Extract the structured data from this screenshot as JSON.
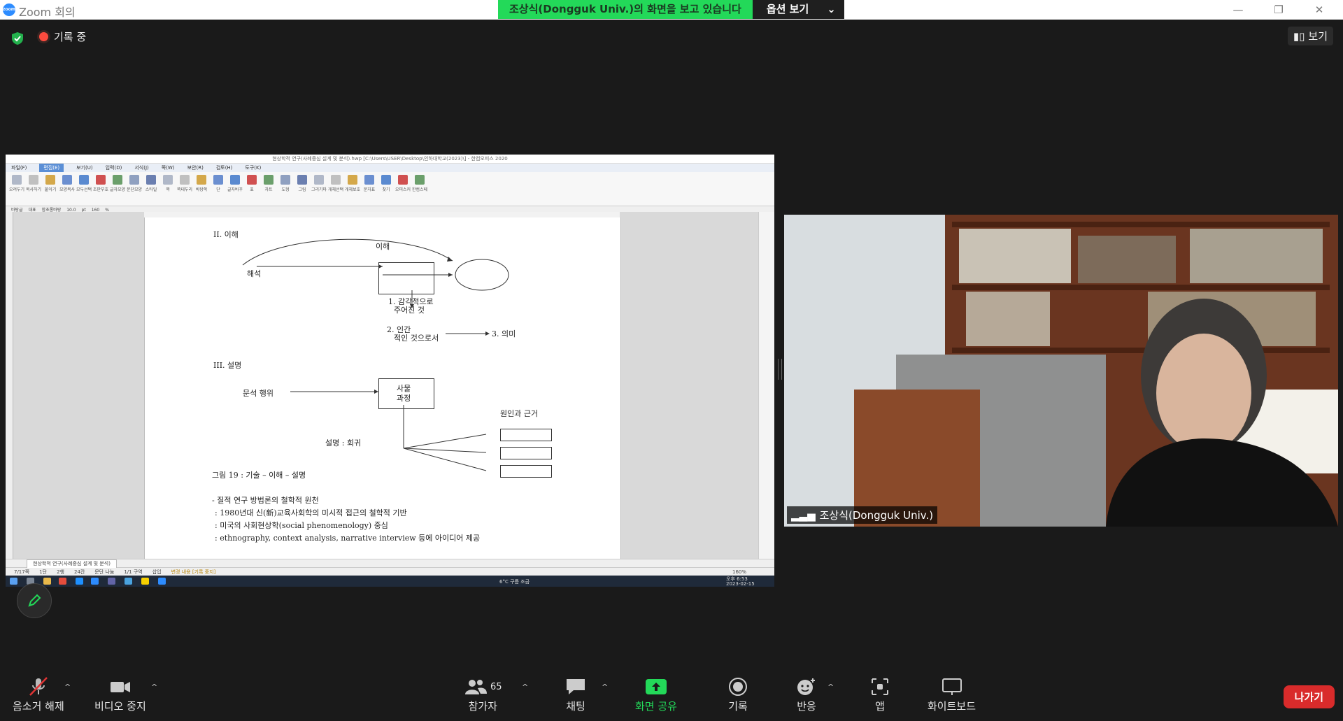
{
  "window": {
    "title": "Zoom 회의",
    "logo_text": "zoom",
    "banner_text": "조상식(Dongguk  Univ.)의 화면을 보고 있습니다",
    "banner_options": "옵션 보기"
  },
  "meeting": {
    "recording_label": "기록 중",
    "view_label": "보기"
  },
  "shared_screen": {
    "hwp_title": "현상학적 연구(사례중심 설계 및 분석).hwp [C:\\Users\\USER\\Desktop\\인하대학교(2023)\\] - 한컴오피스 2020",
    "menu": [
      "파일(F)",
      "편집(E)",
      "보기(U)",
      "입력(D)",
      "서식(J)",
      "쪽(W)",
      "보안(R)",
      "검토(H)",
      "도구(K)"
    ],
    "ribbon": [
      "오려두기",
      "복사하기",
      "붙이기",
      "모양복사",
      "모두선택",
      "조판부호지우기",
      "글자모양",
      "문단모양",
      "스타일",
      "쪽",
      "쪽테두리",
      "바탕쪽",
      "단",
      "글자바꾸기",
      "표",
      "차트",
      "도형",
      "그림",
      "그리기마당",
      "개체선택",
      "개체보호",
      "문자표",
      "찾기",
      "오피스커뮤니케이터",
      "한컴스페이스"
    ],
    "format_bar": [
      "바탕글",
      "대표",
      "함초롬바탕",
      "10.0",
      "pt",
      "160",
      "%"
    ],
    "doc": {
      "heading2": "II. 이해",
      "label_ihae": "이해",
      "label_haeseok": "해석",
      "step1": "1. 감각적으로",
      "step1b": "주어진 것",
      "step2": "2. 인간",
      "step2b": "적인 것으로서",
      "step3": "3. 의미",
      "heading3": "III. 설명",
      "label_act": "문석 행위",
      "label_process": "사물",
      "label_process2": "과정",
      "label_cause": "원인과 근거",
      "label_explain": "설명 : 회귀",
      "caption": "그림 19 : 기술 – 이해 – 설명",
      "bullet1": "- 질적 연구 방법론의 철학적 원천",
      "bullet2": "  : 1980년대 신(新)교육사회학의 미시적 접근의 철학적 기반",
      "bullet3": "  : 미국의 사회현상학(social phenomenology) 중심",
      "bullet4": "  : ethnography, context analysis, narrative interview 등에 아이디어 제공"
    },
    "status_tab": "현상학적 연구(사례중심 설계 및 분석)",
    "status_items": [
      "7/17쪽",
      "1단",
      "2행",
      "24칸",
      "문단 나눔",
      "1/1 구역",
      "삽입",
      "변경 내용 [기록 중지]"
    ],
    "zoom_pct": "160%",
    "weather": "6°C 구름 조금",
    "clock": "오후 6:53",
    "date": "2023-02-15"
  },
  "video": {
    "participant_name": "조상식(Dongguk Univ.)"
  },
  "toolbar": {
    "mute_label": "음소거 해제",
    "video_label": "비디오 중지",
    "participants_label": "참가자",
    "participants_count": "65",
    "chat_label": "채팅",
    "share_label": "화면 공유",
    "record_label": "기록",
    "reactions_label": "반응",
    "apps_label": "앱",
    "whiteboard_label": "화이트보드",
    "leave_label": "나가기"
  },
  "colors": {
    "share_green": "#23d959",
    "leave_red": "#d92b2b",
    "mute_red": "#e03434"
  }
}
